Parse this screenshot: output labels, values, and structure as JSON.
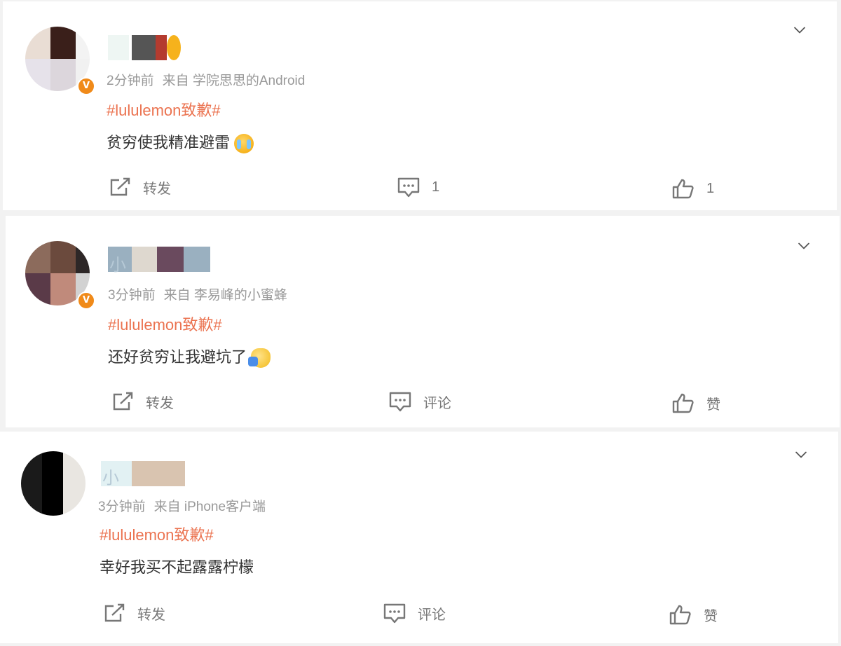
{
  "posts": [
    {
      "name": "",
      "time": "2分钟前",
      "source": "来自 学院思思的Android",
      "hashtag": "#lululemon致歉#",
      "content": "贫穷使我精准避雷",
      "emoji": "cry-face-emoji",
      "repost_label": "转发",
      "comment_label": "1",
      "like_label": "1"
    },
    {
      "name": "小",
      "time": "3分钟前",
      "source": "来自 李易峰的小蜜蜂",
      "hashtag": "#lululemon致歉#",
      "content": "还好贫穷让我避坑了",
      "emoji": "waving-emoji",
      "repost_label": "转发",
      "comment_label": "评论",
      "like_label": "赞"
    },
    {
      "name": "小",
      "time": "3分钟前",
      "source": "来自 iPhone客户端",
      "hashtag": "#lululemon致歉#",
      "content": "幸好我买不起露露柠檬",
      "emoji": "",
      "repost_label": "转发",
      "comment_label": "评论",
      "like_label": "赞"
    }
  ],
  "colors": {
    "hashtag": "#eb7350",
    "meta": "#999999",
    "badge": "#f08a19"
  }
}
